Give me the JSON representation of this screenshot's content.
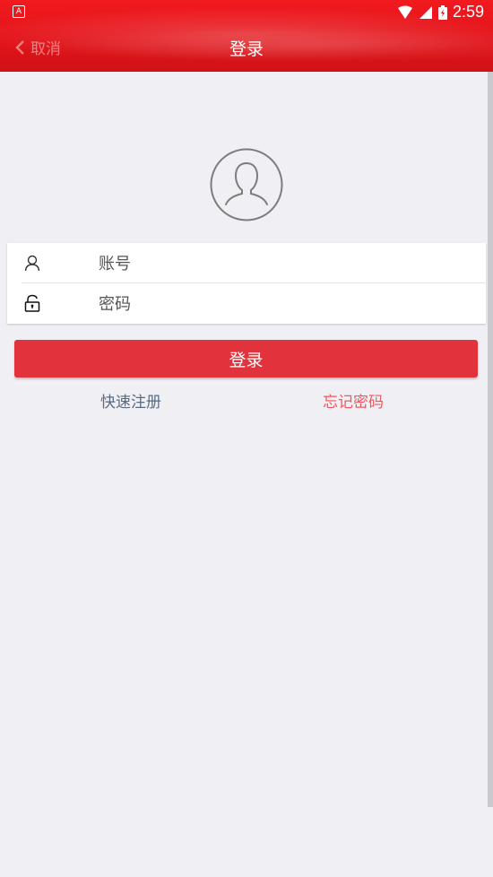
{
  "status_bar": {
    "left_badge": "A",
    "time": "2:59",
    "icons": [
      "wifi-icon",
      "cellular-signal-icon",
      "battery-charging-icon"
    ]
  },
  "nav": {
    "back_label": "取消",
    "title": "登录"
  },
  "avatar": {
    "icon": "user-avatar-icon"
  },
  "form": {
    "account": {
      "placeholder": "账号",
      "value": "",
      "icon": "person-icon"
    },
    "password": {
      "placeholder": "密码",
      "value": "",
      "icon": "unlock-icon"
    }
  },
  "actions": {
    "login_label": "登录",
    "register_label": "快速注册",
    "forgot_label": "忘记密码"
  },
  "colors": {
    "header_red": "#e2141a",
    "button_red": "#e2333d",
    "forgot_red": "#f1575f",
    "register_blue": "#5a6b80",
    "background": "#efeff4"
  }
}
